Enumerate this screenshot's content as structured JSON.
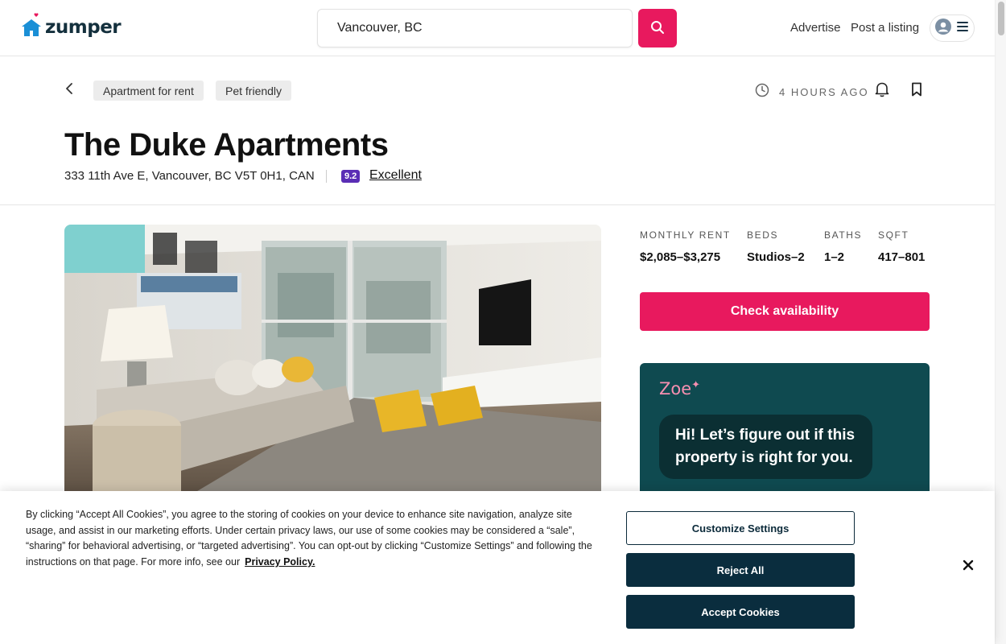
{
  "header": {
    "brand": "zumper",
    "search_value": "Vancouver, BC",
    "nav": [
      "Advertise",
      "Post a listing"
    ]
  },
  "listing": {
    "tags": [
      "Apartment for rent",
      "Pet friendly"
    ],
    "posted": "4 HOURS AGO",
    "title": "The Duke Apartments",
    "address": "333 11th Ave E, Vancouver, BC V5T 0H1, CAN",
    "score": "9.2",
    "score_label": "Excellent"
  },
  "stats": [
    {
      "label": "MONTHLY RENT",
      "value": "$2,085–$3,275"
    },
    {
      "label": "BEDS",
      "value": "Studios–2"
    },
    {
      "label": "BATHS",
      "value": "1–2"
    },
    {
      "label": "SQFT",
      "value": "417–801"
    }
  ],
  "cta": {
    "check_availability": "Check availability"
  },
  "zoe": {
    "name": "Zoe",
    "message": "Hi! Let’s figure out if this property is right for you."
  },
  "cookie": {
    "text": "By clicking “Accept All Cookies”, you agree to the storing of cookies on your device to enhance site navigation, analyze site usage, and assist in our marketing efforts. Under certain privacy laws, our use of some cookies may be considered a “sale”, “sharing” for behavioral advertising, or “targeted advertising”. You can opt-out by clicking “Customize Settings” and following the instructions on that page. For more info, see our",
    "link": "Privacy Policy.",
    "buttons": {
      "customize": "Customize Settings",
      "reject": "Reject All",
      "accept": "Accept Cookies"
    }
  },
  "colors": {
    "brand_pink": "#e8195e",
    "score_purple": "#5a2db5",
    "zoe_teal": "#0f4a50",
    "cookie_navy": "#0a2d3e"
  }
}
